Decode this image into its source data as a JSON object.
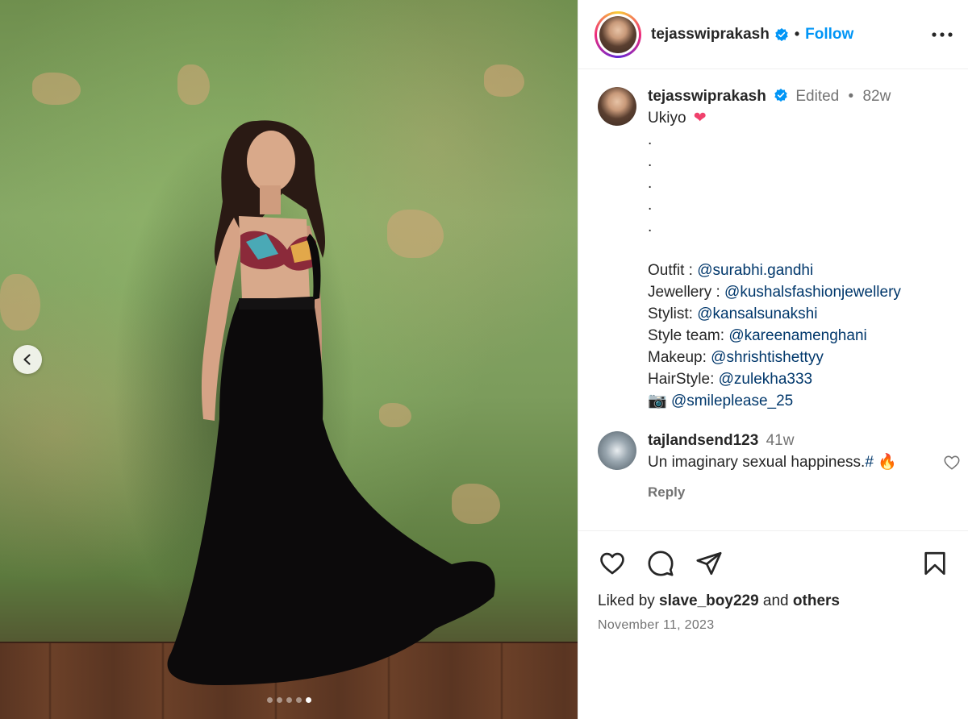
{
  "media": {
    "slide_count": 5,
    "active_slide": 5
  },
  "header": {
    "username": "tejasswiprakash",
    "separator": "•",
    "follow_label": "Follow"
  },
  "caption": {
    "username": "tejasswiprakash",
    "edited": "Edited",
    "separator": "•",
    "age": "82w",
    "text": "Ukiyo",
    "emoji": "❤",
    "dots": [
      ".",
      ".",
      ".",
      ".",
      "."
    ],
    "credits": [
      {
        "label": "Outfit : ",
        "mention": "@surabhi.gandhi"
      },
      {
        "label": "Jewellery : ",
        "mention": "@kushalsfashionjewellery"
      },
      {
        "label": "Stylist: ",
        "mention": "@kansalsunakshi"
      },
      {
        "label": "Style team: ",
        "mention": "@kareenamenghani"
      },
      {
        "label": "Makeup: ",
        "mention": "@shrishtishettyy"
      },
      {
        "label": "HairStyle: ",
        "mention": "@zulekha333"
      },
      {
        "label": "📷 ",
        "mention": "@smileplease_25"
      }
    ]
  },
  "comment": {
    "username": "tajlandsend123",
    "age": "41w",
    "text": "Un imaginary sexual happiness.",
    "hashtag": "#",
    "emoji": "🔥",
    "reply_label": "Reply"
  },
  "footer": {
    "liked_by_prefix": "Liked by ",
    "liked_by_user": "slave_boy229",
    "liked_by_mid": " and ",
    "liked_by_others": "others",
    "date": "November 11, 2023"
  },
  "colors": {
    "link": "#0095f6",
    "mention": "#00376b",
    "muted": "#737373",
    "verified": "#0095f6"
  }
}
